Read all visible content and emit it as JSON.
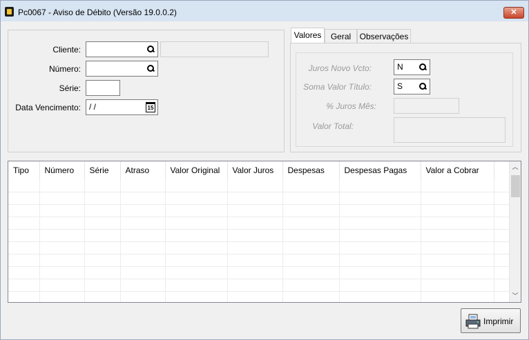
{
  "window": {
    "title": "Pc0067 - Aviso de Débito   (Versão 19.0.0.2)",
    "close_label": "✕"
  },
  "form": {
    "cliente_label": "Cliente:",
    "numero_label": "Número:",
    "serie_label": "Série:",
    "data_venc_label": "Data Vencimento:",
    "data_venc_value": " / /",
    "calendar_day": "15"
  },
  "tabs": [
    {
      "label": "Valores"
    },
    {
      "label": "Geral"
    },
    {
      "label": "Observações"
    }
  ],
  "valores": {
    "juros_novo_vcto_label": "Juros Novo Vcto:",
    "juros_novo_vcto_value": "N",
    "soma_valor_titulo_label": "Soma Valor Título:",
    "soma_valor_titulo_value": "S",
    "juros_mes_label": "% Juros Mês:",
    "valor_total_label": "Valor Total:"
  },
  "grid": {
    "columns": [
      "Tipo",
      "Número",
      "Série",
      "Atraso",
      "Valor Original",
      "Valor Juros",
      "Despesas",
      "Despesas Pagas",
      "Valor a Cobrar",
      ""
    ]
  },
  "buttons": {
    "imprimir_label": "Imprimir"
  },
  "colors": {
    "titlebar": "#d7e4f2",
    "close_button": "#c9462b",
    "window_bg": "#f0f0f0"
  }
}
